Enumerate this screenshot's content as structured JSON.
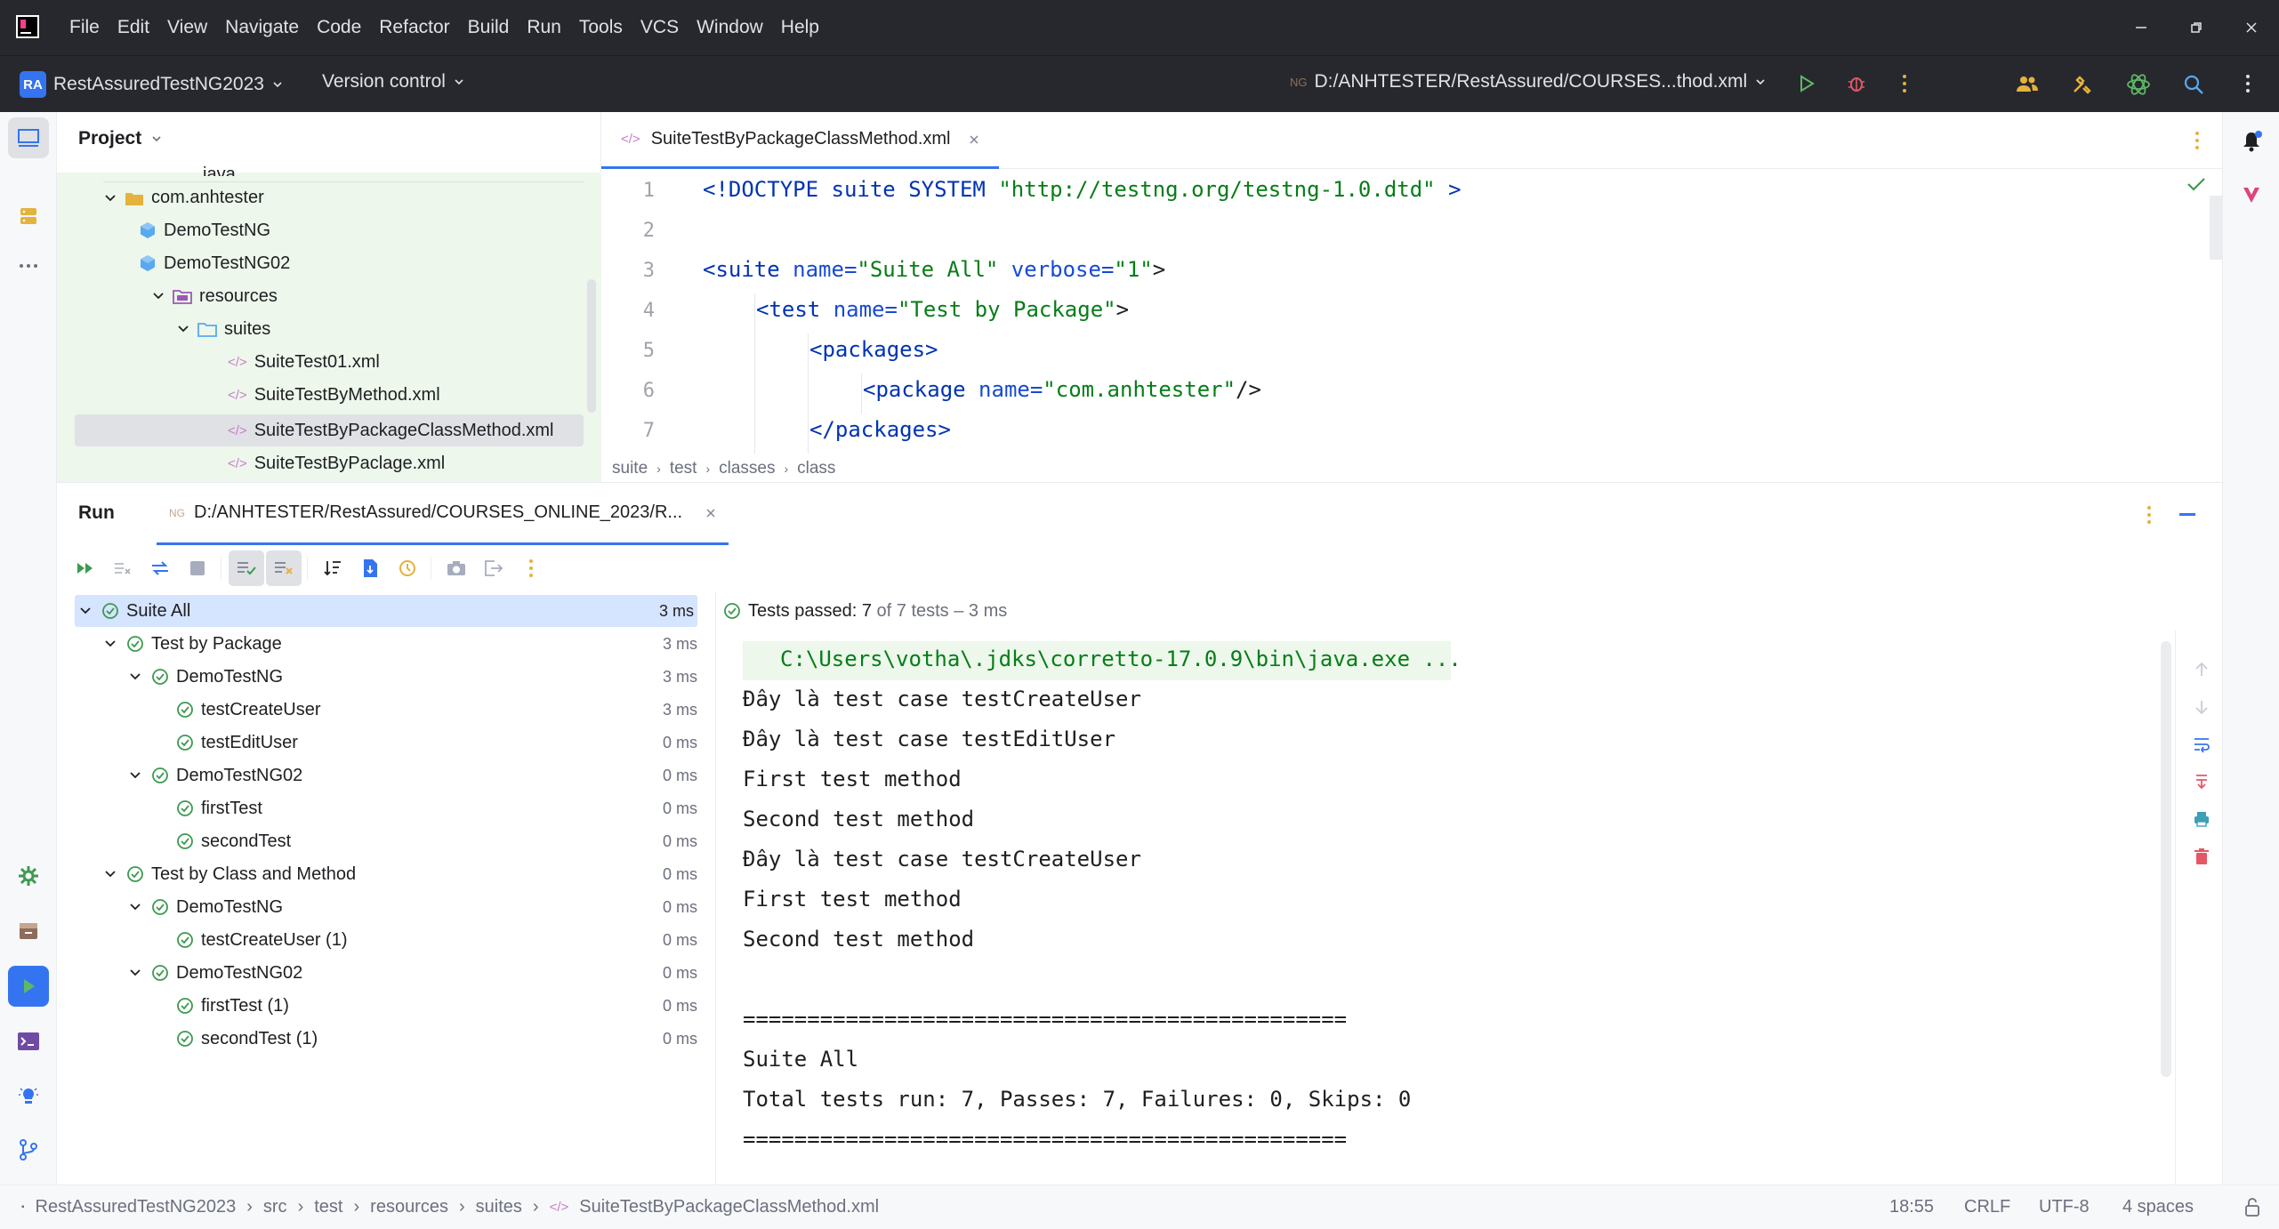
{
  "menu": [
    "File",
    "Edit",
    "View",
    "Navigate",
    "Code",
    "Refactor",
    "Build",
    "Run",
    "Tools",
    "VCS",
    "Window",
    "Help"
  ],
  "toolbar": {
    "project_badge": "RA",
    "project_name": "RestAssuredTestNG2023",
    "version_control": "Version control",
    "run_config": "D:/ANHTESTER/RestAssured/COURSES...thod.xml"
  },
  "project_panel": {
    "title": "Project",
    "items": [
      {
        "label": "java",
        "kind": "folder-src"
      },
      {
        "label": "com.anhtester",
        "kind": "package"
      },
      {
        "label": "DemoTestNG",
        "kind": "class"
      },
      {
        "label": "DemoTestNG02",
        "kind": "class"
      },
      {
        "label": "resources",
        "kind": "folder-res"
      },
      {
        "label": "suites",
        "kind": "folder"
      },
      {
        "label": "SuiteTest01.xml",
        "kind": "xml"
      },
      {
        "label": "SuiteTestByMethod.xml",
        "kind": "xml"
      },
      {
        "label": "SuiteTestByPackageClassMethod.xml",
        "kind": "xml",
        "selected": true
      },
      {
        "label": "SuiteTestByPaclage.xml",
        "kind": "xml"
      }
    ]
  },
  "editor": {
    "tab": "SuiteTestByPackageClassMethod.xml",
    "line_numbers": [
      "1",
      "2",
      "3",
      "4",
      "5",
      "6",
      "7"
    ],
    "lines": {
      "l1a": "<!DOCTYPE suite SYSTEM ",
      "l1b": "\"http://testng.org/testng-1.0.dtd\"",
      "l1c": " >",
      "l3a": "<suite ",
      "l3b": "name=",
      "l3c": "\"Suite All\"",
      "l3d": " verbose=",
      "l3e": "\"1\"",
      "l3f": ">",
      "l4a": "<test ",
      "l4b": "name=",
      "l4c": "\"Test by Package\"",
      "l4d": ">",
      "l5a": "<packages>",
      "l6a": "<package ",
      "l6b": "name=",
      "l6c": "\"com.anhtester\"",
      "l6d": "/>",
      "l7a": "</packages>"
    },
    "breadcrumbs": [
      "suite",
      "test",
      "classes",
      "class"
    ]
  },
  "run": {
    "title": "Run",
    "tab": "D:/ANHTESTER/RestAssured/COURSES_ONLINE_2023/R...",
    "status_prefix": "Tests passed: ",
    "status_count": "7",
    "status_rest": " of 7 tests – 3 ms",
    "tree": [
      {
        "label": "Suite All",
        "dur": "3 ms",
        "level": 0,
        "selected": true
      },
      {
        "label": "Test by Package",
        "dur": "3 ms",
        "level": 1
      },
      {
        "label": "DemoTestNG",
        "dur": "3 ms",
        "level": 2
      },
      {
        "label": "testCreateUser",
        "dur": "3 ms",
        "level": 3
      },
      {
        "label": "testEditUser",
        "dur": "0 ms",
        "level": 3
      },
      {
        "label": "DemoTestNG02",
        "dur": "0 ms",
        "level": 2
      },
      {
        "label": "firstTest",
        "dur": "0 ms",
        "level": 3
      },
      {
        "label": "secondTest",
        "dur": "0 ms",
        "level": 3
      },
      {
        "label": "Test by Class and Method",
        "dur": "0 ms",
        "level": 1
      },
      {
        "label": "DemoTestNG",
        "dur": "0 ms",
        "level": 2
      },
      {
        "label": "testCreateUser (1)",
        "dur": "0 ms",
        "level": 3
      },
      {
        "label": "DemoTestNG02",
        "dur": "0 ms",
        "level": 2
      },
      {
        "label": "firstTest (1)",
        "dur": "0 ms",
        "level": 3
      },
      {
        "label": "secondTest (1)",
        "dur": "0 ms",
        "level": 3
      }
    ],
    "console": [
      "C:\\Users\\votha\\.jdks\\corretto-17.0.9\\bin\\java.exe ...",
      "Đây là test case testCreateUser",
      "Đây là test case testEditUser",
      "First test method",
      "Second test method",
      "Đây là test case testCreateUser",
      "First test method",
      "Second test method",
      "",
      "===============================================",
      "Suite All",
      "Total tests run: 7, Passes: 7, Failures: 0, Skips: 0",
      "==============================================="
    ]
  },
  "statusbar": {
    "path": [
      "RestAssuredTestNG2023",
      "src",
      "test",
      "resources",
      "suites",
      "SuiteTestByPackageClassMethod.xml"
    ],
    "position": "18:55",
    "line_sep": "CRLF",
    "encoding": "UTF-8",
    "indent": "4 spaces"
  },
  "colors": {
    "accent": "#3574f0",
    "pass": "#3d9a50",
    "titlebar": "#27282e"
  }
}
